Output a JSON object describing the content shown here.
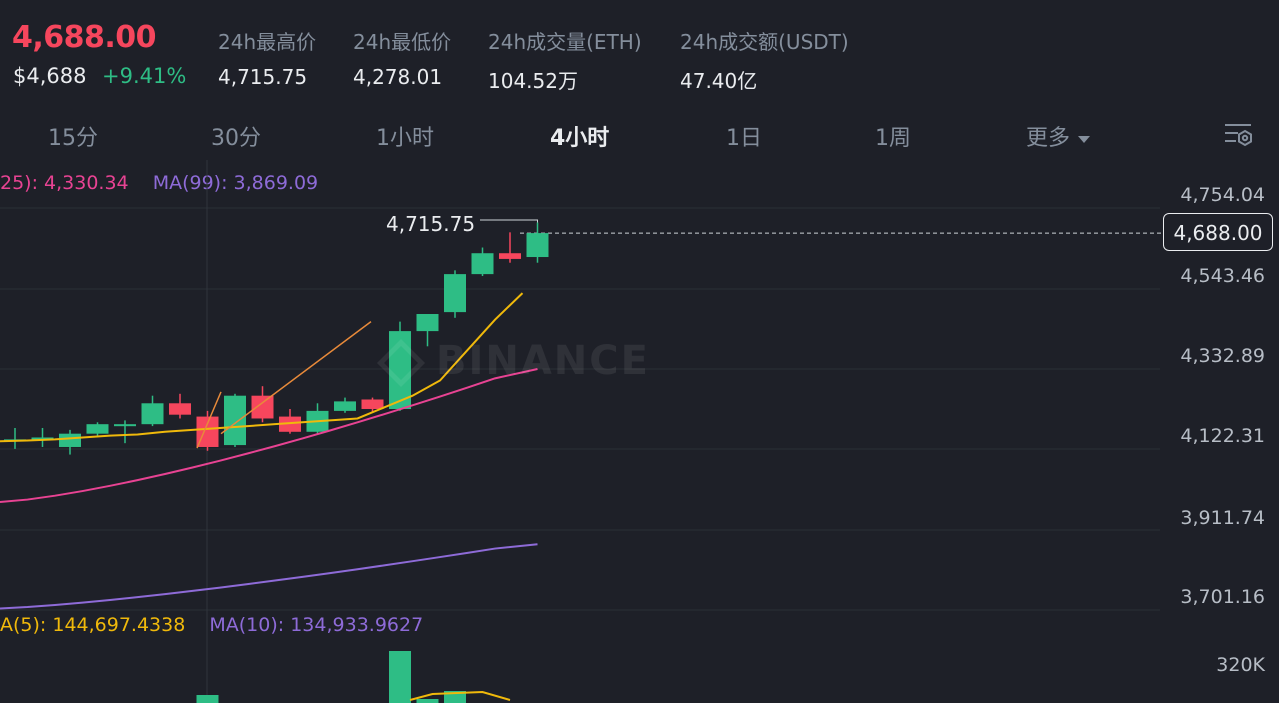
{
  "ticker": {
    "last_price": "4,688.00",
    "usd_price": "$4,688",
    "change_pct": "+9.41%"
  },
  "stats": [
    {
      "label": "24h最高价",
      "value": "4,715.75"
    },
    {
      "label": "24h最低价",
      "value": "4,278.01"
    },
    {
      "label": "24h成交量(ETH)",
      "value": "104.52万"
    },
    {
      "label": "24h成交额(USDT)",
      "value": "47.40亿"
    }
  ],
  "intervals": {
    "items": [
      "15分",
      "30分",
      "1小时",
      "4小时",
      "1日",
      "1周",
      "更多"
    ],
    "active": "4小时"
  },
  "ma_legend": {
    "ma25": "25): 4,330.34",
    "ma99": "MA(99): 3,869.09"
  },
  "vol_legend": {
    "ma5": "A(5): 144,697.4338",
    "ma10": "MA(10): 134,933.9627"
  },
  "price_axis": [
    "4,754.04",
    "4,543.46",
    "4,332.89",
    "4,122.31",
    "3,911.74",
    "3,701.16"
  ],
  "current_price_label": "4,688.00",
  "high_label": "4,715.75",
  "volume_axis": "320K",
  "watermark": "BINANCE",
  "colors": {
    "up": "#2ebd85",
    "down": "#f6465d",
    "ma_short": "#f0b90b",
    "ma25": "#e84393",
    "ma99": "#8e6bd8",
    "trend_line": "#e88a3a",
    "grid": "#2b2f36"
  },
  "chart_data": {
    "type": "candlestick",
    "candles": [
      {
        "o": 4145,
        "h": 4175,
        "l": 4120,
        "c": 4145
      },
      {
        "o": 4150,
        "h": 4175,
        "l": 4125,
        "c": 4150
      },
      {
        "o": 4125,
        "h": 4170,
        "l": 4105,
        "c": 4160
      },
      {
        "o": 4160,
        "h": 4190,
        "l": 4150,
        "c": 4185
      },
      {
        "o": 4185,
        "h": 4195,
        "l": 4135,
        "c": 4185
      },
      {
        "o": 4185,
        "h": 4260,
        "l": 4180,
        "c": 4240
      },
      {
        "o": 4240,
        "h": 4265,
        "l": 4200,
        "c": 4210
      },
      {
        "o": 4205,
        "h": 4220,
        "l": 4115,
        "c": 4125
      },
      {
        "o": 4130,
        "h": 4265,
        "l": 4125,
        "c": 4260
      },
      {
        "o": 4260,
        "h": 4285,
        "l": 4190,
        "c": 4200
      },
      {
        "o": 4205,
        "h": 4225,
        "l": 4160,
        "c": 4165
      },
      {
        "o": 4165,
        "h": 4240,
        "l": 4160,
        "c": 4220
      },
      {
        "o": 4220,
        "h": 4255,
        "l": 4215,
        "c": 4245
      },
      {
        "o": 4250,
        "h": 4255,
        "l": 4215,
        "c": 4225
      },
      {
        "o": 4225,
        "h": 4455,
        "l": 4220,
        "c": 4430
      },
      {
        "o": 4430,
        "h": 4440,
        "l": 4390,
        "c": 4475
      },
      {
        "o": 4480,
        "h": 4590,
        "l": 4465,
        "c": 4580
      },
      {
        "o": 4580,
        "h": 4650,
        "l": 4575,
        "c": 4635
      },
      {
        "o": 4635,
        "h": 4690,
        "l": 4610,
        "c": 4620
      },
      {
        "o": 4625,
        "h": 4715.75,
        "l": 4610,
        "c": 4688
      }
    ],
    "ma25_start": 3980,
    "ma25_end": 4330.34,
    "ma99_start": 3700,
    "ma99_end": 3869.09,
    "y_axis": [
      3701.16,
      4754.04
    ]
  }
}
